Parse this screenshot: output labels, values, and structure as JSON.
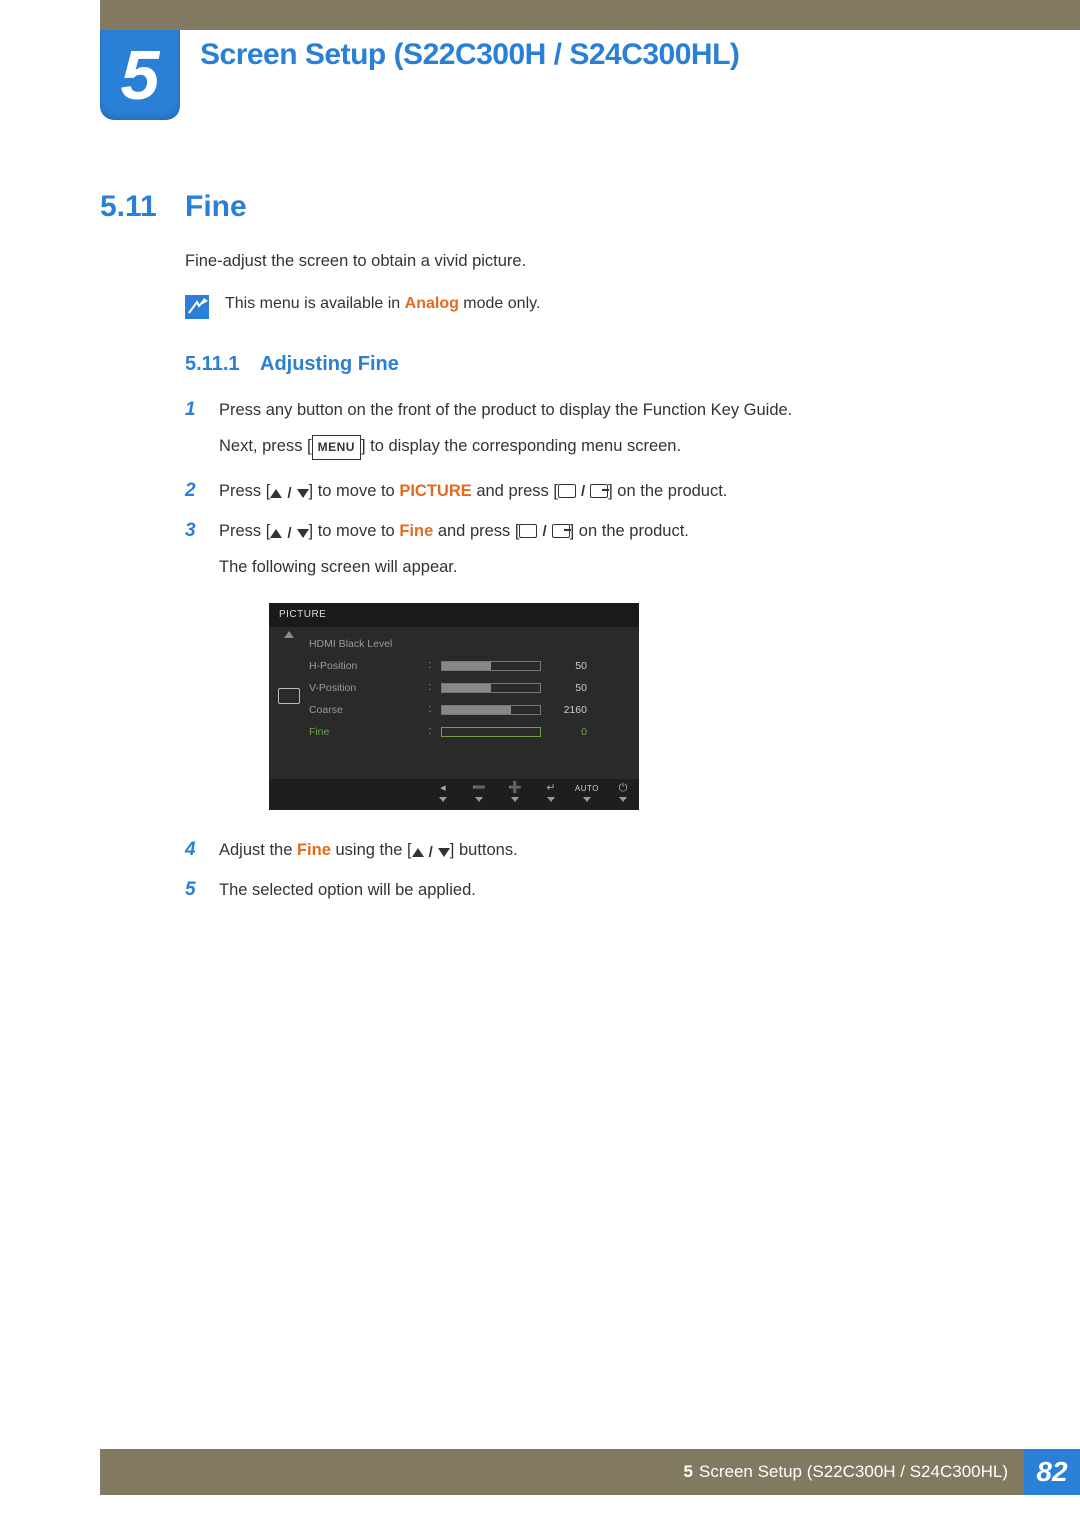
{
  "chapter": {
    "number": "5",
    "title": "Screen Setup (S22C300H / S24C300HL)"
  },
  "section": {
    "number": "5.11",
    "title": "Fine",
    "description": "Fine-adjust the screen to obtain a vivid picture."
  },
  "note": {
    "prefix": "This menu is available in ",
    "highlight": "Analog",
    "suffix": " mode only."
  },
  "subsection": {
    "number": "5.11.1",
    "title": "Adjusting Fine"
  },
  "steps": {
    "s1": {
      "num": "1",
      "line1": "Press any button on the front of the product to display the Function Key Guide.",
      "line2a": "Next, press [",
      "menuKey": "MENU",
      "line2b": "] to display the corresponding menu screen."
    },
    "s2": {
      "num": "2",
      "a": "Press [",
      "b": "] to move to ",
      "highlight": "PICTURE",
      "c": " and press [",
      "d": "] on the product."
    },
    "s3": {
      "num": "3",
      "a": "Press [",
      "b": "] to move to ",
      "highlight": "Fine",
      "c": " and press [",
      "d": "] on the product.",
      "line2": "The following screen will appear."
    },
    "s4": {
      "num": "4",
      "a": "Adjust the ",
      "highlight": "Fine",
      "b": " using the [",
      "c": "] buttons."
    },
    "s5": {
      "num": "5",
      "text": "The selected option will be applied."
    }
  },
  "osd": {
    "header": "PICTURE",
    "rows": {
      "r0": {
        "label": "HDMI Black Level"
      },
      "r1": {
        "label": "H-Position",
        "value": "50",
        "fill": 50
      },
      "r2": {
        "label": "V-Position",
        "value": "50",
        "fill": 50
      },
      "r3": {
        "label": "Coarse",
        "value": "2160",
        "fill": 70
      },
      "r4": {
        "label": "Fine",
        "value": "0",
        "fill": 0,
        "selected": true
      }
    },
    "footer": {
      "auto": "AUTO"
    }
  },
  "footer": {
    "chapterNum": "5",
    "text": "Screen Setup (S22C300H / S24C300HL)",
    "page": "82"
  }
}
